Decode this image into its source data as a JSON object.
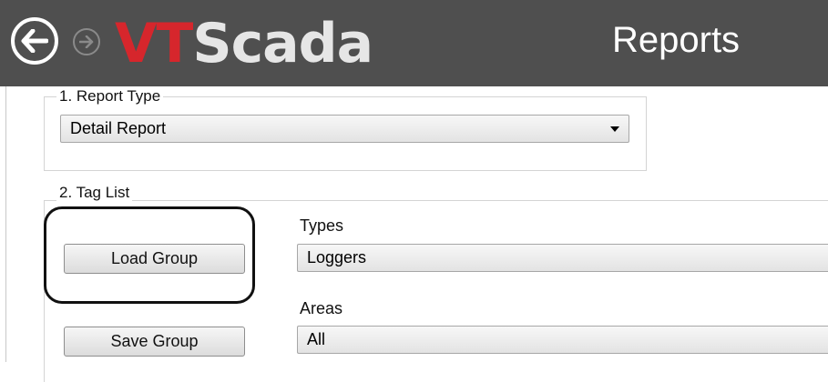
{
  "header": {
    "logo_vt": "VT",
    "logo_rest": "Scada",
    "title": "Reports"
  },
  "report_type": {
    "legend": "1. Report Type",
    "selected": "Detail Report"
  },
  "tag_list": {
    "legend": "2. Tag List",
    "load_group_label": "Load Group",
    "save_group_label": "Save Group",
    "types_label": "Types",
    "types_value": "Loggers",
    "areas_label": "Areas",
    "areas_value": "All"
  },
  "icons": {
    "back": "back-arrow-icon",
    "forward": "forward-arrow-icon"
  },
  "colors": {
    "header_bg": "#4f4f4f",
    "logo_red": "#d6262c"
  }
}
